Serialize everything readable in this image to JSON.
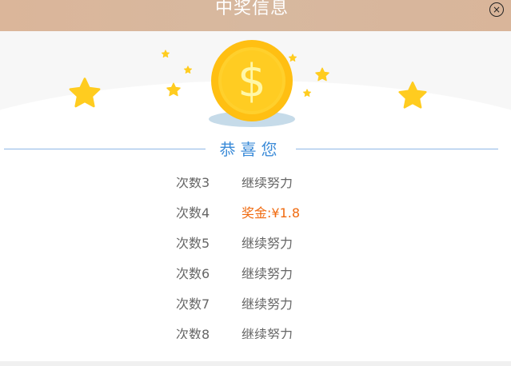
{
  "dialog": {
    "title": "中奖信息",
    "close_glyph": "×",
    "congrats": "恭喜您"
  },
  "records": [
    {
      "label": "次数3",
      "result": "继续努力",
      "is_prize": false
    },
    {
      "label": "次数4",
      "result": "奖金:¥1.8",
      "is_prize": true
    },
    {
      "label": "次数5",
      "result": "继续努力",
      "is_prize": false
    },
    {
      "label": "次数6",
      "result": "继续努力",
      "is_prize": false
    },
    {
      "label": "次数7",
      "result": "继续努力",
      "is_prize": false
    },
    {
      "label": "次数8",
      "result": "继续努力",
      "is_prize": false
    }
  ],
  "colors": {
    "title_bar": "#d9b69b",
    "accent_blue": "#3b8bd8",
    "prize_orange": "#f06a0f",
    "coin_gold": "#ffc21a",
    "star_gold": "#ffcc1f"
  },
  "icons": {
    "close": "close-icon",
    "coin": "dollar-coin-icon",
    "star": "star-icon"
  }
}
